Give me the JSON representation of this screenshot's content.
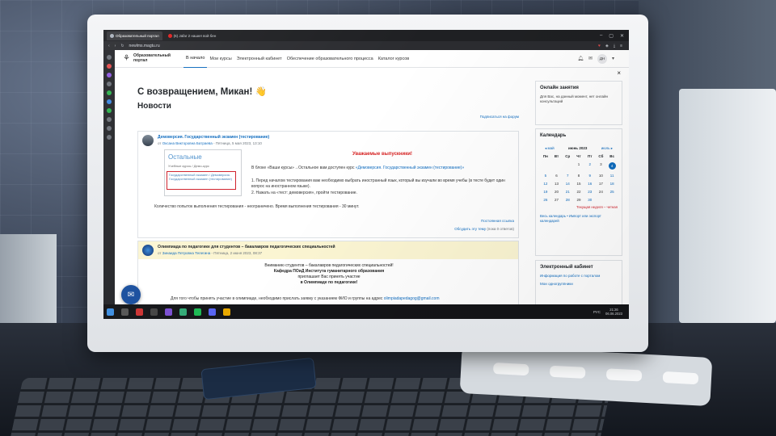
{
  "browser": {
    "tabs": [
      {
        "label": "Образовательный портал",
        "active": true
      },
      {
        "label": "(6) Jafar 2 нашел вой бен",
        "active": false
      }
    ],
    "url": "newlms.magtu.ru"
  },
  "site": {
    "logo_text": "Образовательный портал",
    "nav": [
      "В начало",
      "Мои курсы",
      "Электронный кабинет",
      "Обеспечение образовательного процесса",
      "Каталог курсов"
    ],
    "avatar_initials": "ДН"
  },
  "main": {
    "welcome": "С возвращением, Микан! 👋",
    "news_title": "Новости",
    "subscribe": "Подписаться на форум"
  },
  "post1": {
    "title": "Демоверсия. Государственный экзамен (тестирование)",
    "meta_prefix": "от",
    "author": "Оксана Викторовна Батраева",
    "date": "- Пятница, 5 мая 2023, 13:10",
    "thumb_title": "Остальные",
    "thumb_crumb": "Учебные курсы / Демо-курс",
    "thumb_box": "Государственный экзамен / Демоверсия. Государственный экзамен (тестирование)",
    "warning": "Уважаемые выпускники!",
    "para": "В блоке «Ваши курсы»→Остальное вам доступен курс",
    "para_link": "«Демоверсия. Государственный экзамен (тестирование)»",
    "step1": "1. Перед началом тестирования вам необходимо выбрать иностранный язык, который вы изучали во время учебы (в тесте будет один вопрос на иностранном языке).",
    "step2": "2. Нажать на «тест: демоверсия», пройти тестирование.",
    "count": "Количество попыток выполнения тестирования - неограничено. Время выполнения тестирования - 30 минут.",
    "permalink": "Постоянная ссылка",
    "discuss": "Обсудить эту тему",
    "discuss_count": "(пока 0 ответов)"
  },
  "post2": {
    "title": "Олимпиада по педагогике для студентов – бакалавров педагогических специальностей",
    "meta_prefix": "от",
    "author": "Зинаида Петровна Телегина",
    "date": "- Пятница, 2 июня 2023, 08:37",
    "line1": "Вниманию студентов – бакалавров педагогических специальностей!",
    "line2": "Кафедра ПОиД Института гуманитарного образования",
    "line3": "приглашает Вас принять участие",
    "line4": "в Олимпиаде по педагогике!",
    "foot": "Для того чтобы принять участие в олимпиаде, необходимо прислать заявку с указанием ФИО и группы на адрес",
    "email": "olimpiadapedagog@gmail.com"
  },
  "right": {
    "close": "×",
    "online": {
      "title": "Онлайн занятия",
      "text": "Для Вас, на данный момент, нет онлайн консультаций"
    },
    "calendar": {
      "title": "Календарь",
      "prev": "◂ май",
      "month": "июнь 2023",
      "next": "июль ▸",
      "days": [
        "Пн",
        "Вт",
        "Ср",
        "Чт",
        "Пт",
        "Сб",
        "Вс"
      ],
      "weeks": [
        [
          "",
          "",
          "",
          "1",
          "2",
          "3",
          "4"
        ],
        [
          "5",
          "6",
          "7",
          "8",
          "9",
          "10",
          "11"
        ],
        [
          "12",
          "13",
          "14",
          "15",
          "16",
          "17",
          "18"
        ],
        [
          "19",
          "20",
          "21",
          "22",
          "23",
          "24",
          "25"
        ],
        [
          "26",
          "27",
          "28",
          "29",
          "30",
          "",
          ""
        ]
      ],
      "today": "4",
      "legend": "Текущая неделя – четная",
      "link": "Весь календарь • Импорт или экспорт календарей"
    },
    "ecab": {
      "title": "Электронный кабинет",
      "link1": "Информация по работе с порталом",
      "link2": "Мои одногруппники"
    }
  },
  "taskbar": {
    "lang": "РУС",
    "time": "21:26",
    "date": "06.06.2023"
  },
  "colors": {
    "accent": "#0f6cbf",
    "warning": "#d62020",
    "highlight_box": "#d0202a"
  }
}
